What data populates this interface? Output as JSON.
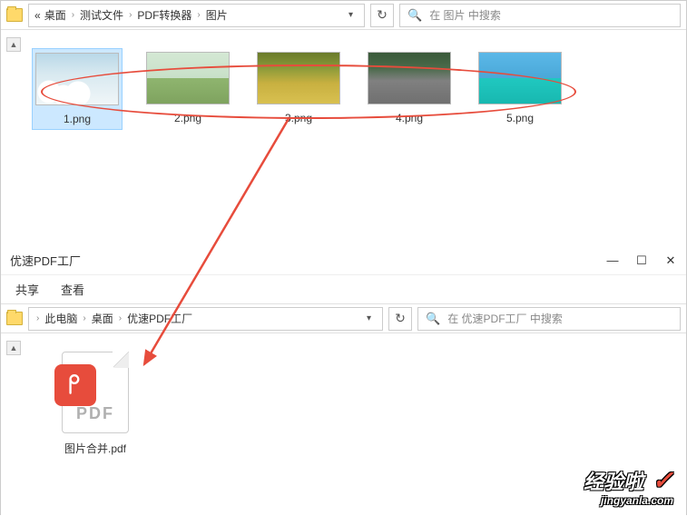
{
  "top_window": {
    "breadcrumb": {
      "prefix": "«",
      "items": [
        "桌面",
        "测试文件",
        "PDF转换器",
        "图片"
      ]
    },
    "search": {
      "placeholder": "在 图片 中搜索"
    },
    "files": [
      {
        "name": "1.png",
        "selected": true
      },
      {
        "name": "2.png",
        "selected": false
      },
      {
        "name": "3.png",
        "selected": false
      },
      {
        "name": "4.png",
        "selected": false
      },
      {
        "name": "5.png",
        "selected": false
      }
    ]
  },
  "bottom_window": {
    "title": "优速PDF工厂",
    "toolbar": {
      "share": "共享",
      "view": "查看"
    },
    "breadcrumb": {
      "items": [
        "此电脑",
        "桌面",
        "优速PDF工厂"
      ]
    },
    "search": {
      "placeholder": "在 优速PDF工厂 中搜索"
    },
    "files": [
      {
        "name": "图片合并.pdf",
        "badge_text": "PDF"
      }
    ]
  },
  "watermark": {
    "main": "经验啦",
    "sub": "jingyanla.com"
  },
  "icons": {
    "refresh": "↻",
    "search": "🔍",
    "dropdown": "▾",
    "scroll_up": "▲",
    "sep": "›",
    "minimize": "—",
    "maximize": "☐",
    "close": "✕",
    "check": "✓"
  }
}
